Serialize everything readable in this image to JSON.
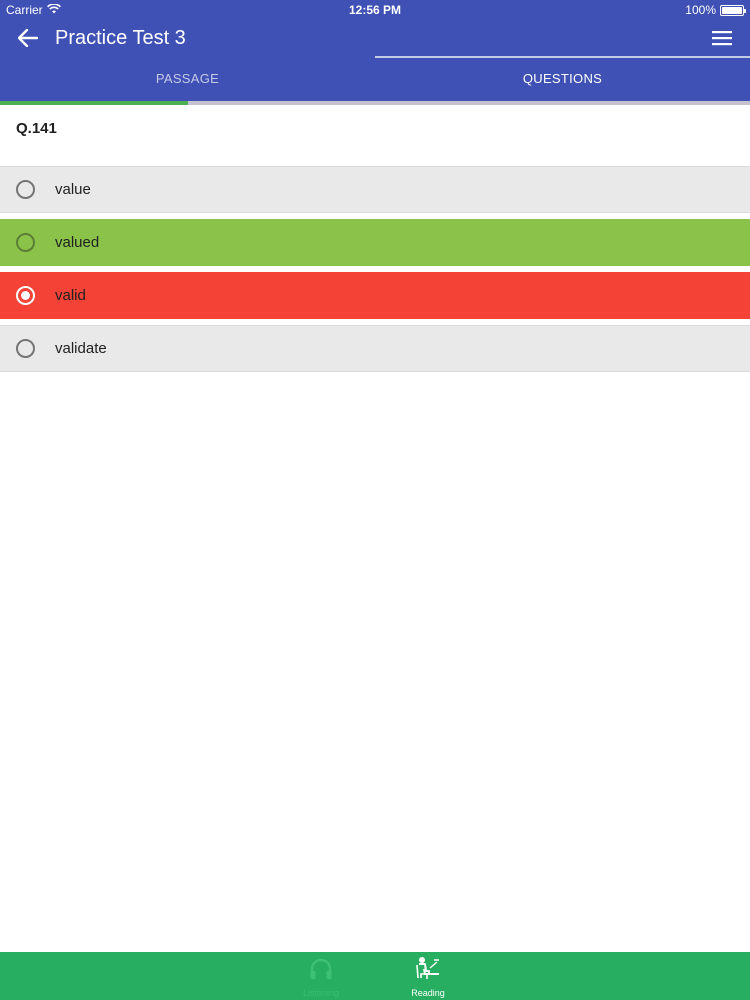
{
  "status_bar": {
    "carrier": "Carrier",
    "time": "12:56 PM",
    "battery_text": "100%",
    "battery_level": 1.0
  },
  "header": {
    "title": "Practice Test 3",
    "back_icon": "arrow-left-icon",
    "menu_icon": "hamburger-menu-icon"
  },
  "tabs": [
    {
      "label": "PASSAGE",
      "active": false
    },
    {
      "label": "QUESTIONS",
      "active": true
    }
  ],
  "progress": {
    "fraction": 0.25,
    "color": "#4caf50"
  },
  "question": {
    "number": "Q.141"
  },
  "options": [
    {
      "label": "value",
      "state": "neutral",
      "selected": false,
      "background": "#e9e9e9"
    },
    {
      "label": "valued",
      "state": "correct",
      "selected": false,
      "background": "#8bc34a"
    },
    {
      "label": "valid",
      "state": "wrong",
      "selected": true,
      "background": "#f44336"
    },
    {
      "label": "validate",
      "state": "neutral",
      "selected": false,
      "background": "#e9e9e9"
    }
  ],
  "bottom_nav": {
    "background": "#27ae60",
    "items": [
      {
        "label": "Listening",
        "icon": "headphones-icon",
        "active": false
      },
      {
        "label": "Reading",
        "icon": "reading-person-icon",
        "active": true
      }
    ]
  },
  "colors": {
    "primary": "#3f51b5",
    "tab_inactive": "#c5cae9"
  }
}
